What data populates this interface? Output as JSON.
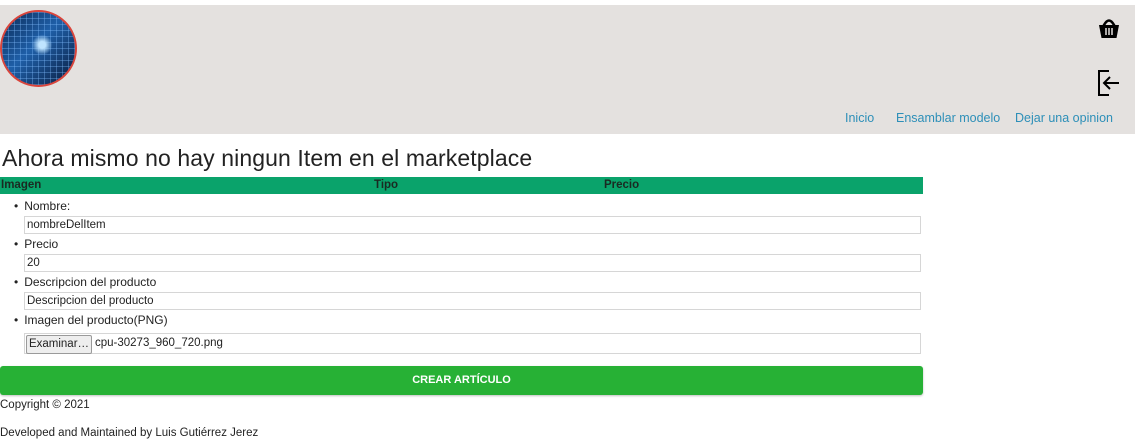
{
  "header": {
    "logo_icon": "cpu-circuit-logo",
    "cart_icon": "shopping-basket-icon",
    "logout_icon": "logout-icon",
    "nav": [
      {
        "label": "Inicio"
      },
      {
        "label": "Ensamblar modelo"
      },
      {
        "label": "Dejar una opinion"
      }
    ]
  },
  "main": {
    "heading": "Ahora mismo no hay ningun Item en el marketplace",
    "table_headers": [
      "Imagen",
      "Tipo",
      "Precio"
    ]
  },
  "form": {
    "nombre_label": "Nombre:",
    "nombre_value": "nombreDelItem",
    "precio_label": "Precio",
    "precio_value": "20",
    "descripcion_label": "Descripcion del producto",
    "descripcion_value": "Descripcion del producto",
    "imagen_label": "Imagen del producto(PNG)",
    "file_button": "Examinar…",
    "file_name": "cpu-30273_960_720.png",
    "submit_label": "CREAR ARTÍCULO"
  },
  "footer": {
    "copyright": "Copyright © 2021",
    "developer": "Developed and Maintained by Luis Gutiérrez Jerez"
  },
  "colors": {
    "header_bg": "#e4e1df",
    "nav_link": "#2d8fb8",
    "table_header": "#0aa36b",
    "submit_button": "#27b135",
    "logo_border": "#d9453c"
  }
}
